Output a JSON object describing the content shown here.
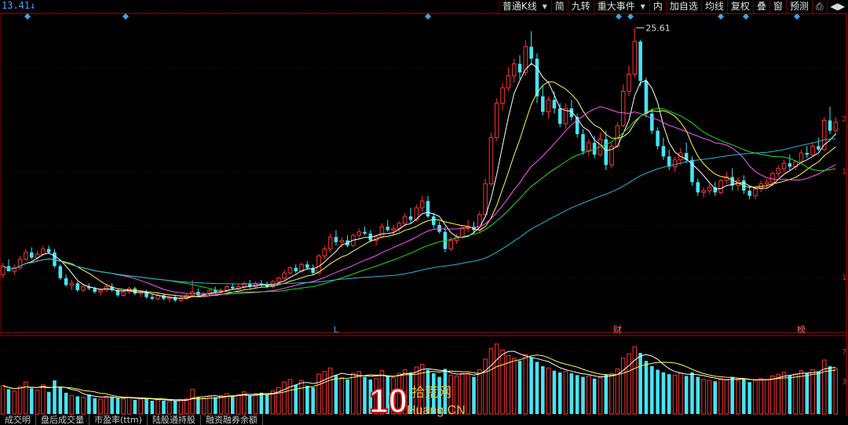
{
  "header": {
    "price_label": "13.41↓",
    "toolbar": [
      "普通K线",
      "简",
      "九转",
      "重大事件",
      "内",
      "加自选",
      "均线",
      "复权",
      "叠",
      "窗",
      "预测",
      "⎙",
      "◀▶"
    ]
  },
  "bottom_tabs": [
    "成交明",
    "盘后成交量",
    "市盈率(ttm)",
    "陆股通持股",
    "融资融券余额"
  ],
  "watermark": {
    "num": "10",
    "cn": "拾荒网",
    "en": "Huang.CN"
  },
  "chart_data": [
    {
      "type": "candlestick",
      "title": "",
      "annotations": [
        {
          "text": "25.61",
          "type": "max-price"
        },
        {
          "text": "L",
          "type": "event-marker"
        },
        {
          "text": "财",
          "type": "event-marker"
        },
        {
          "text": "榜",
          "type": "event-marker"
        }
      ],
      "y_tick_labels": [
        "2",
        "1",
        "1"
      ],
      "colors": {
        "up": "#ff3333",
        "down": "#44e5f5",
        "ma5": "#ffffff",
        "ma10": "#ffff55",
        "ma20": "#ff55ff",
        "ma30": "#22dd22",
        "ma60": "#29b6d8",
        "grid": "#5a0000",
        "axis": "#b00000"
      },
      "ohlc": [
        [
          11.2,
          11.9,
          11.0,
          11.7
        ],
        [
          11.7,
          12.1,
          11.5,
          11.4
        ],
        [
          11.4,
          11.8,
          11.2,
          11.6
        ],
        [
          11.6,
          12.3,
          11.5,
          12.1
        ],
        [
          12.1,
          12.7,
          12.0,
          12.5
        ],
        [
          12.5,
          12.8,
          12.1,
          12.2
        ],
        [
          12.2,
          12.6,
          12.0,
          12.4
        ],
        [
          12.4,
          12.9,
          12.3,
          12.7
        ],
        [
          12.7,
          12.9,
          12.4,
          12.5
        ],
        [
          12.5,
          12.7,
          11.6,
          11.7
        ],
        [
          11.7,
          11.8,
          10.9,
          11.0
        ],
        [
          11.0,
          11.2,
          10.5,
          10.6
        ],
        [
          10.6,
          10.9,
          10.3,
          10.7
        ],
        [
          10.7,
          10.8,
          10.2,
          10.3
        ],
        [
          10.3,
          10.6,
          10.2,
          10.5
        ],
        [
          10.5,
          10.7,
          10.3,
          10.4
        ],
        [
          10.4,
          10.5,
          10.1,
          10.2
        ],
        [
          10.2,
          10.4,
          10.0,
          10.3
        ],
        [
          10.3,
          10.6,
          10.2,
          10.5
        ],
        [
          10.5,
          10.7,
          10.2,
          10.3
        ],
        [
          10.3,
          10.4,
          9.9,
          10.0
        ],
        [
          10.0,
          10.3,
          9.9,
          10.2
        ],
        [
          10.2,
          10.5,
          10.1,
          10.4
        ],
        [
          10.4,
          10.5,
          10.0,
          10.1
        ],
        [
          10.1,
          10.3,
          9.9,
          10.2
        ],
        [
          10.2,
          10.3,
          9.8,
          9.9
        ],
        [
          9.9,
          10.1,
          9.7,
          9.8
        ],
        [
          9.8,
          10.1,
          9.7,
          10.0
        ],
        [
          10.0,
          10.1,
          9.7,
          9.8
        ],
        [
          9.8,
          10.0,
          9.6,
          9.9
        ],
        [
          9.9,
          10.0,
          9.6,
          9.7
        ],
        [
          9.7,
          9.9,
          9.6,
          9.8
        ],
        [
          9.8,
          10.1,
          9.7,
          10.0
        ],
        [
          10.0,
          10.9,
          9.9,
          10.2
        ],
        [
          10.2,
          10.4,
          9.9,
          10.0
        ],
        [
          10.0,
          10.2,
          9.9,
          10.1
        ],
        [
          10.1,
          10.4,
          10.0,
          10.3
        ],
        [
          10.3,
          10.5,
          10.1,
          10.2
        ],
        [
          10.2,
          10.4,
          10.1,
          10.3
        ],
        [
          10.3,
          10.6,
          10.2,
          10.5
        ],
        [
          10.5,
          10.7,
          10.3,
          10.4
        ],
        [
          10.4,
          10.6,
          10.3,
          10.5
        ],
        [
          10.5,
          10.8,
          10.4,
          10.7
        ],
        [
          10.7,
          10.9,
          10.4,
          10.5
        ],
        [
          10.5,
          10.8,
          10.4,
          10.7
        ],
        [
          10.7,
          10.9,
          10.5,
          10.6
        ],
        [
          10.6,
          10.8,
          10.4,
          10.5
        ],
        [
          10.5,
          10.9,
          10.4,
          10.8
        ],
        [
          10.8,
          11.1,
          10.7,
          11.0
        ],
        [
          11.0,
          11.5,
          10.9,
          11.3
        ],
        [
          11.3,
          11.7,
          11.2,
          11.6
        ],
        [
          11.6,
          11.8,
          11.3,
          11.4
        ],
        [
          11.4,
          11.9,
          11.3,
          11.8
        ],
        [
          11.8,
          12.0,
          11.5,
          11.6
        ],
        [
          11.6,
          11.8,
          11.2,
          11.3
        ],
        [
          11.3,
          12.4,
          11.2,
          12.3
        ],
        [
          12.3,
          12.9,
          12.1,
          12.7
        ],
        [
          12.7,
          13.6,
          12.5,
          13.4
        ],
        [
          13.4,
          13.8,
          12.9,
          13.1
        ],
        [
          13.1,
          13.4,
          12.8,
          13.2
        ],
        [
          13.2,
          13.5,
          12.8,
          12.9
        ],
        [
          12.9,
          13.6,
          12.8,
          13.5
        ],
        [
          13.5,
          13.9,
          13.3,
          13.7
        ],
        [
          13.7,
          14.0,
          13.5,
          13.6
        ],
        [
          13.6,
          13.8,
          13.1,
          13.2
        ],
        [
          13.2,
          13.5,
          12.9,
          13.4
        ],
        [
          13.4,
          14.2,
          13.3,
          14.0
        ],
        [
          14.0,
          14.4,
          13.7,
          13.8
        ],
        [
          13.8,
          14.1,
          13.5,
          13.9
        ],
        [
          13.9,
          14.3,
          13.7,
          14.2
        ],
        [
          14.2,
          14.8,
          14.0,
          14.6
        ],
        [
          14.6,
          15.1,
          14.2,
          14.4
        ],
        [
          14.4,
          15.3,
          14.3,
          15.1
        ],
        [
          15.1,
          15.8,
          14.9,
          15.5
        ],
        [
          15.5,
          15.8,
          14.5,
          14.6
        ],
        [
          14.6,
          14.8,
          13.9,
          14.1
        ],
        [
          14.1,
          14.3,
          13.6,
          13.7
        ],
        [
          13.7,
          14.0,
          12.5,
          12.7
        ],
        [
          12.7,
          13.4,
          12.6,
          13.2
        ],
        [
          13.2,
          13.6,
          13.0,
          13.4
        ],
        [
          13.4,
          14.1,
          13.3,
          13.9
        ],
        [
          13.9,
          14.4,
          13.7,
          14.0
        ],
        [
          14.0,
          14.3,
          13.6,
          13.8
        ],
        [
          13.8,
          14.9,
          13.7,
          14.7
        ],
        [
          14.7,
          16.8,
          14.6,
          16.5
        ],
        [
          16.5,
          19.5,
          16.4,
          19.2
        ],
        [
          19.2,
          21.5,
          19.0,
          21.2
        ],
        [
          21.2,
          22.4,
          20.8,
          22.1
        ],
        [
          22.1,
          23.3,
          21.9,
          22.8
        ],
        [
          22.8,
          23.8,
          22.4,
          23.5
        ],
        [
          23.5,
          24.0,
          22.6,
          23.0
        ],
        [
          23.0,
          24.9,
          22.8,
          24.5
        ],
        [
          24.5,
          25.4,
          23.4,
          23.8
        ],
        [
          23.8,
          24.1,
          21.2,
          21.6
        ],
        [
          21.6,
          22.2,
          20.5,
          20.7
        ],
        [
          20.7,
          21.6,
          20.3,
          21.4
        ],
        [
          21.4,
          21.9,
          20.6,
          20.9
        ],
        [
          20.9,
          21.2,
          19.8,
          20.0
        ],
        [
          20.0,
          21.2,
          19.7,
          20.9
        ],
        [
          20.9,
          21.4,
          20.2,
          20.4
        ],
        [
          20.4,
          20.6,
          19.2,
          19.4
        ],
        [
          19.4,
          19.7,
          18.2,
          18.4
        ],
        [
          18.4,
          19.1,
          18.1,
          18.9
        ],
        [
          18.9,
          19.3,
          18.0,
          18.2
        ],
        [
          18.2,
          19.5,
          18.1,
          19.1
        ],
        [
          19.1,
          19.6,
          17.3,
          17.6
        ],
        [
          17.6,
          18.9,
          17.4,
          18.7
        ],
        [
          18.7,
          20.1,
          18.6,
          19.9
        ],
        [
          19.9,
          22.3,
          19.8,
          21.9
        ],
        [
          21.9,
          23.4,
          21.6,
          22.9
        ],
        [
          22.9,
          25.6,
          22.7,
          24.8
        ],
        [
          24.8,
          24.9,
          22.2,
          22.5
        ],
        [
          22.5,
          22.7,
          20.4,
          20.6
        ],
        [
          20.6,
          20.9,
          19.4,
          19.6
        ],
        [
          19.6,
          19.8,
          18.5,
          18.7
        ],
        [
          18.7,
          19.2,
          17.9,
          18.1
        ],
        [
          18.1,
          18.5,
          17.3,
          17.5
        ],
        [
          17.5,
          18.1,
          17.2,
          17.9
        ],
        [
          17.9,
          18.6,
          17.6,
          18.3
        ],
        [
          18.3,
          18.9,
          17.7,
          17.9
        ],
        [
          17.9,
          18.1,
          16.4,
          16.6
        ],
        [
          16.6,
          16.8,
          15.8,
          16.0
        ],
        [
          16.0,
          16.3,
          15.7,
          16.1
        ],
        [
          16.1,
          16.5,
          15.9,
          16.3
        ],
        [
          16.3,
          16.6,
          15.8,
          16.0
        ],
        [
          16.0,
          16.8,
          15.9,
          16.7
        ],
        [
          16.7,
          17.2,
          16.5,
          16.9
        ],
        [
          16.9,
          17.4,
          16.1,
          16.4
        ],
        [
          16.4,
          16.9,
          16.1,
          16.7
        ],
        [
          16.7,
          17.0,
          15.9,
          16.1
        ],
        [
          16.1,
          16.4,
          15.6,
          15.8
        ],
        [
          15.8,
          16.3,
          15.6,
          16.2
        ],
        [
          16.2,
          16.7,
          16.0,
          16.5
        ],
        [
          16.5,
          16.8,
          16.3,
          16.6
        ],
        [
          16.6,
          17.2,
          16.5,
          17.1
        ],
        [
          17.1,
          17.6,
          16.9,
          17.4
        ],
        [
          17.4,
          17.9,
          17.2,
          17.7
        ],
        [
          17.7,
          18.2,
          17.3,
          17.5
        ],
        [
          17.5,
          17.9,
          17.3,
          17.8
        ],
        [
          17.8,
          18.5,
          17.7,
          18.3
        ],
        [
          18.3,
          18.7,
          18.0,
          18.2
        ],
        [
          18.2,
          18.9,
          18.1,
          18.7
        ],
        [
          18.7,
          19.2,
          18.4,
          18.5
        ],
        [
          18.5,
          20.4,
          18.4,
          20.2
        ],
        [
          20.2,
          21.0,
          19.4,
          19.6
        ],
        [
          19.6,
          20.4,
          19.3,
          20.1
        ]
      ],
      "volume": [
        3.2,
        2.8,
        2.6,
        3.1,
        3.6,
        2.9,
        2.7,
        3.3,
        2.5,
        3.8,
        3.0,
        2.4,
        2.1,
        2.0,
        1.9,
        2.2,
        1.8,
        1.7,
        2.0,
        1.9,
        1.8,
        1.7,
        1.9,
        1.6,
        1.7,
        1.8,
        1.5,
        1.6,
        1.5,
        1.4,
        1.5,
        1.6,
        1.7,
        2.8,
        1.9,
        1.8,
        2.0,
        1.9,
        2.1,
        2.3,
        2.0,
        2.2,
        2.5,
        2.1,
        2.3,
        2.4,
        2.2,
        2.6,
        3.0,
        3.6,
        3.9,
        3.3,
        3.8,
        3.2,
        3.0,
        4.5,
        4.8,
        5.2,
        4.4,
        4.1,
        3.9,
        4.6,
        4.8,
        4.2,
        3.9,
        4.0,
        4.9,
        4.3,
        4.1,
        4.6,
        5.0,
        4.7,
        5.3,
        5.6,
        5.0,
        4.6,
        4.2,
        5.1,
        4.4,
        4.3,
        4.6,
        4.5,
        4.2,
        5.0,
        6.2,
        7.4,
        7.9,
        7.2,
        6.6,
        6.3,
        6.0,
        6.7,
        6.4,
        5.9,
        5.4,
        5.2,
        4.9,
        4.7,
        4.8,
        4.6,
        4.4,
        4.2,
        4.3,
        4.0,
        4.1,
        4.5,
        4.6,
        5.1,
        6.3,
        6.8,
        7.6,
        6.9,
        6.0,
        5.4,
        5.0,
        4.7,
        4.5,
        4.4,
        4.6,
        4.3,
        4.7,
        4.2,
        3.9,
        3.8,
        3.7,
        4.0,
        3.9,
        4.2,
        3.8,
        4.0,
        3.6,
        3.8,
        4.0,
        3.9,
        4.3,
        4.5,
        4.7,
        4.4,
        4.5,
        4.9,
        4.6,
        5.0,
        4.8,
        6.1,
        5.4,
        5.1
      ],
      "volume_y_tick_labels": [
        "7",
        "3"
      ]
    }
  ]
}
